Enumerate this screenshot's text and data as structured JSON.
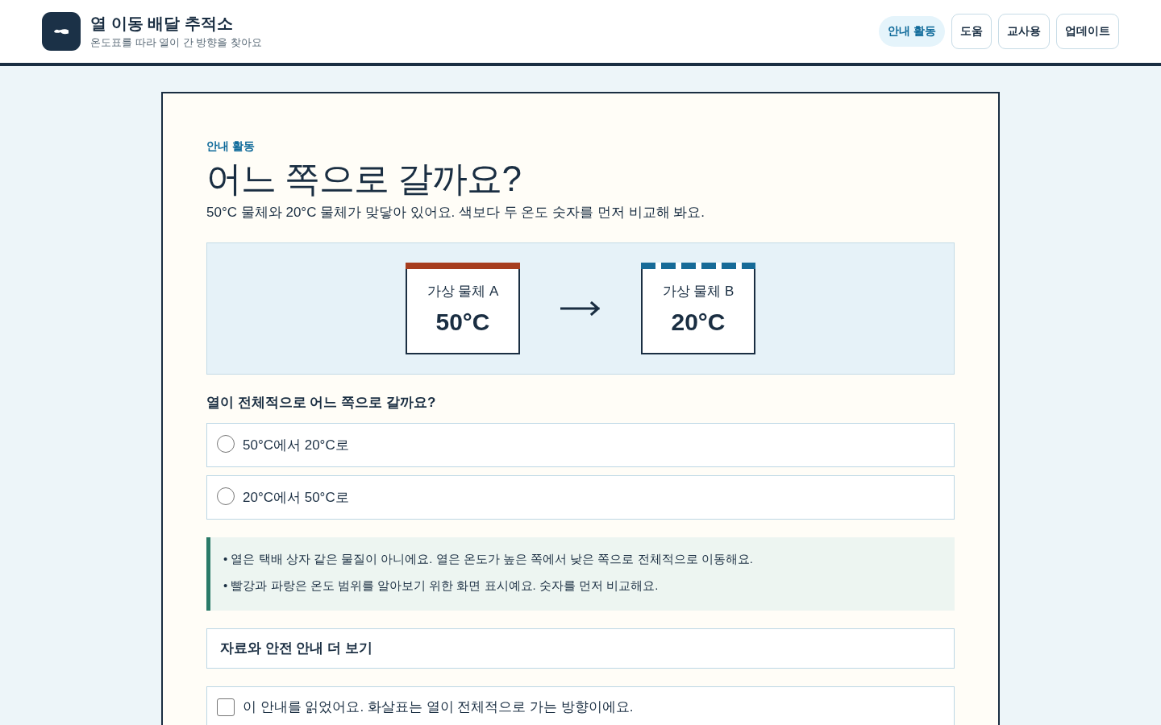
{
  "header": {
    "title": "열 이동 배달 추적소",
    "subtitle": "온도표를 따라 열이 간 방향을 찾아요",
    "nav": [
      {
        "label": "안내 활동",
        "selected": true
      },
      {
        "label": "도움",
        "selected": false
      },
      {
        "label": "교사용",
        "selected": false
      },
      {
        "label": "업데이트",
        "selected": false
      }
    ]
  },
  "activity": {
    "eyebrow": "안내 활동",
    "heading": "어느 쪽으로 갈까요?",
    "intro": "50°C 물체와 20°C 물체가 맞닿아 있어요. 색보다 두 온도 숫자를 먼저 비교해 봐요.",
    "diagram": {
      "objects": [
        {
          "label": "가상 물체 A",
          "temperature": "50°C",
          "color": "#a63d1e",
          "kind": "solid"
        },
        {
          "label": "가상 물체 B",
          "temperature": "20°C",
          "color": "#176b98",
          "kind": "dashed"
        }
      ]
    },
    "question": "열이 전체적으로 어느 쪽으로 갈까요?",
    "options": [
      {
        "label": "50°C에서 20°C로",
        "selected": false
      },
      {
        "label": "20°C에서 50°C로",
        "selected": false
      }
    ],
    "notes": [
      "• 열은 택배 상자 같은 물질이 아니에요. 열은 온도가 높은 쪽에서 낮은 쪽으로 전체적으로 이동해요.",
      "• 빨강과 파랑은 온도 범위를 알아보기 위한 화면 표시예요. 숫자를 먼저 비교해요."
    ],
    "details": {
      "summary": "자료와 안전 안내 더 보기"
    },
    "confirm": {
      "label": "이 안내를 읽었어요. 화살표는 열이 전체적으로 가는 방향이에요.",
      "checked": false
    }
  }
}
